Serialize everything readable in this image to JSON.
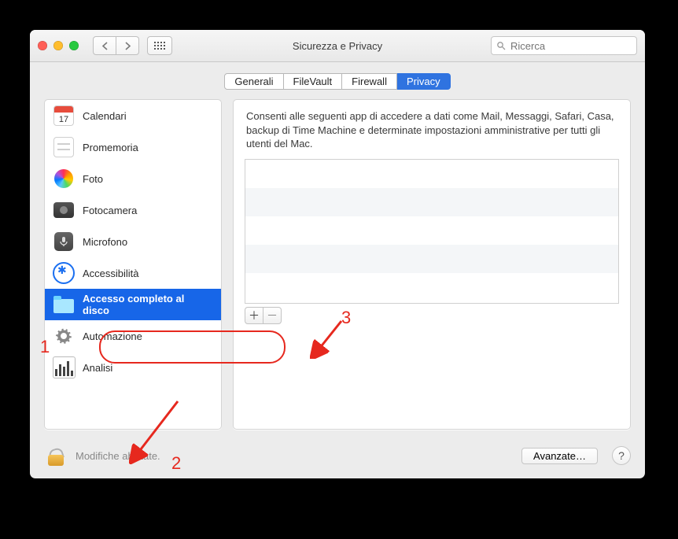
{
  "window": {
    "title": "Sicurezza e Privacy",
    "search_placeholder": "Ricerca"
  },
  "tabs": {
    "generali": "Generali",
    "filevault": "FileVault",
    "firewall": "Firewall",
    "privacy": "Privacy"
  },
  "sidebar": {
    "calendari": {
      "label": "Calendari",
      "cal_num": "17"
    },
    "promemoria": {
      "label": "Promemoria"
    },
    "foto": {
      "label": "Foto"
    },
    "fotocamera": {
      "label": "Fotocamera"
    },
    "microfono": {
      "label": "Microfono"
    },
    "accessibilita": {
      "label": "Accessibilità"
    },
    "full_disk": {
      "label": "Accesso completo al disco"
    },
    "automazione": {
      "label": "Automazione"
    },
    "analisi": {
      "label": "Analisi"
    }
  },
  "right": {
    "desc": "Consenti alle seguenti app di accedere a dati come Mail, Messaggi, Safari, Casa, backup di Time Machine e determinate impostazioni amministrative per tutti gli utenti del Mac.",
    "add": "＋",
    "remove": "－"
  },
  "footer": {
    "lock_text": "Modifiche abilitate.",
    "advanced": "Avanzate…",
    "help": "?"
  },
  "annotations": {
    "n1": "1",
    "n2": "2",
    "n3": "3"
  }
}
